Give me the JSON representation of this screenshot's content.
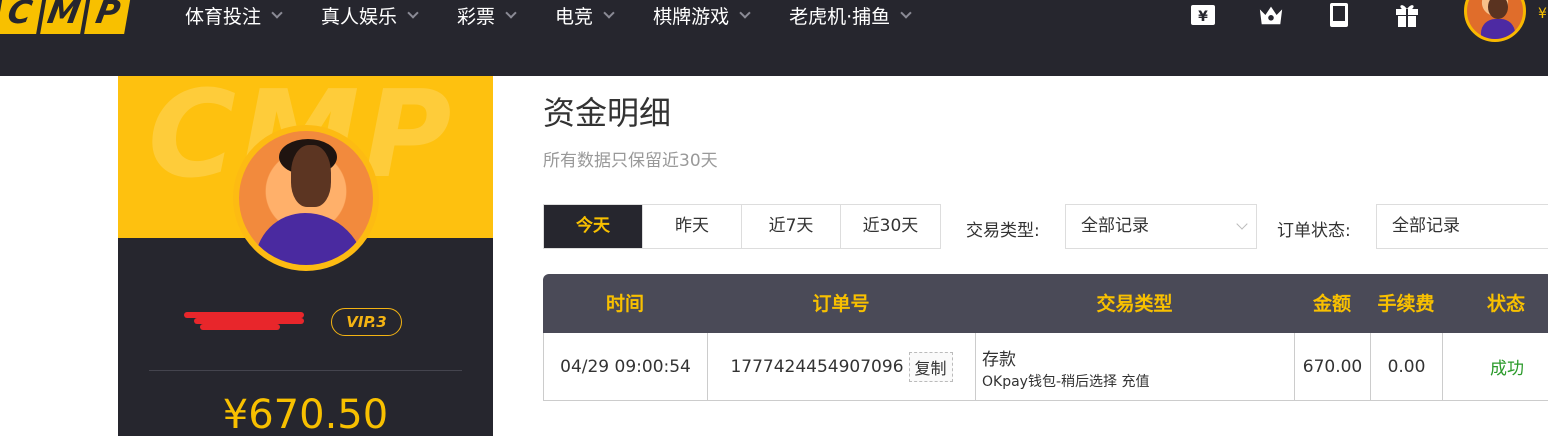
{
  "brand": {
    "logo_letters": [
      "C",
      "M",
      "P"
    ]
  },
  "nav": {
    "items": [
      {
        "label": "体育投注"
      },
      {
        "label": "真人娱乐"
      },
      {
        "label": "彩票"
      },
      {
        "label": "电竞"
      },
      {
        "label": "棋牌游戏"
      },
      {
        "label": "老虎机·捕鱼"
      }
    ],
    "icons": [
      "wallet-icon",
      "crown-icon",
      "mobile-icon",
      "gift-icon"
    ],
    "currency_symbol": "¥"
  },
  "profile": {
    "banner_watermark": "CMP",
    "vip_level": "VIP.3",
    "balance": "¥670.50"
  },
  "page": {
    "title": "资金明细",
    "subtitle": "所有数据只保留近30天"
  },
  "filters": {
    "range_tabs": [
      {
        "label": "今天",
        "active": true
      },
      {
        "label": "昨天",
        "active": false
      },
      {
        "label": "近7天",
        "active": false
      },
      {
        "label": "近30天",
        "active": false
      }
    ],
    "transaction_type_label": "交易类型:",
    "transaction_type_value": "全部记录",
    "order_status_label": "订单状态:",
    "order_status_value": "全部记录"
  },
  "table": {
    "headers": {
      "time": "时间",
      "order_no": "订单号",
      "type": "交易类型",
      "amount": "金额",
      "fee": "手续费",
      "status": "状态"
    },
    "rows": [
      {
        "time": "04/29 09:00:54",
        "order_no": "1777424454907096",
        "copy_label": "复制",
        "type_main": "存款",
        "type_detail": "OKpay钱包-稍后选择 充值",
        "amount": "670.00",
        "fee": "0.00",
        "status": "成功"
      }
    ]
  },
  "colors": {
    "nav_bg": "#26262e",
    "accent_yellow": "#f8c000",
    "table_header_bg": "#4a4a57",
    "status_success": "#2a9a2a"
  }
}
